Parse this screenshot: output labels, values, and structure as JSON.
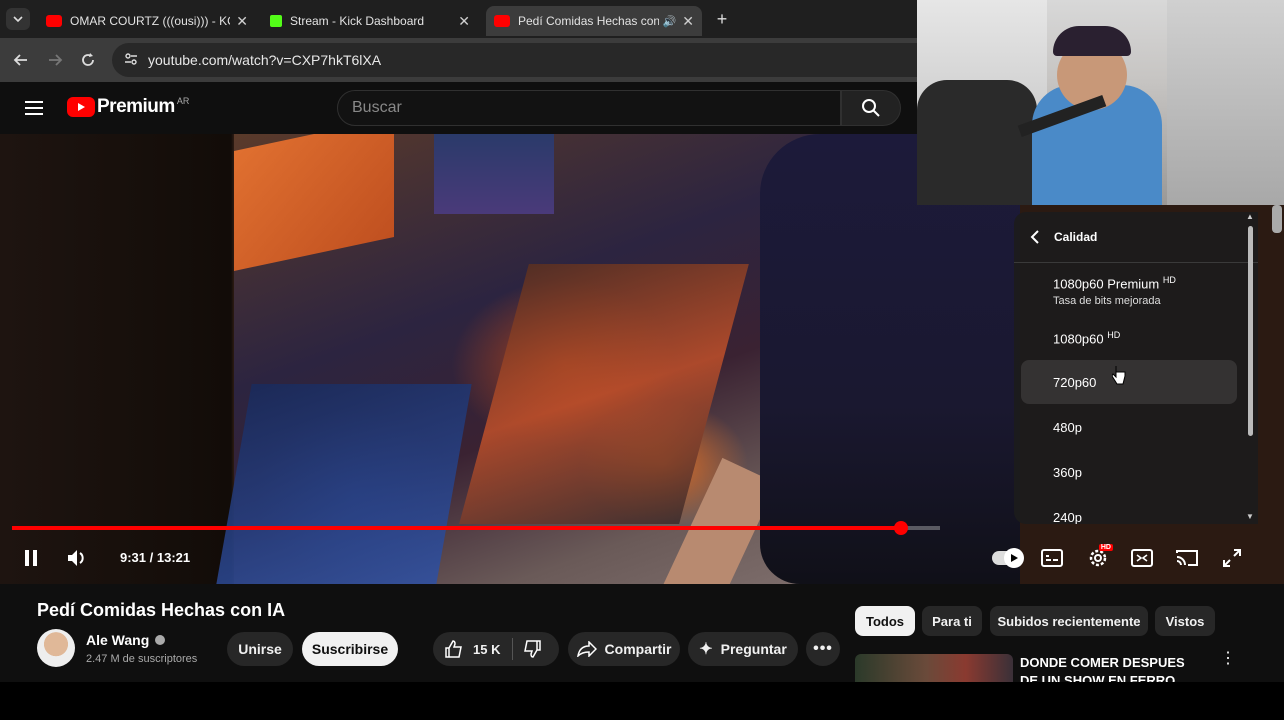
{
  "browser": {
    "tabs": [
      {
        "title": "OMAR COURTZ (((ousi))) - KOK",
        "favicon": "youtube-icon"
      },
      {
        "title": "Stream - Kick Dashboard",
        "favicon": "kick-icon"
      },
      {
        "title": "Pedí Comidas Hechas con I",
        "favicon": "youtube-icon"
      }
    ],
    "url": "youtube.com/watch?v=CXP7hkT6lXA"
  },
  "youtube": {
    "logo_text": "Premium",
    "region": "AR",
    "search_placeholder": "Buscar"
  },
  "player": {
    "time": "9:31 / 13:21",
    "progress": 0.958,
    "buffered": 1.0,
    "quality_menu": {
      "title": "Calidad",
      "options": [
        {
          "label": "1080p60 Premium",
          "badge": "HD",
          "sublabel": "Tasa de bits mejorada"
        },
        {
          "label": "1080p60",
          "badge": "HD"
        },
        {
          "label": "720p60",
          "badge": ""
        },
        {
          "label": "480p",
          "badge": ""
        },
        {
          "label": "360p",
          "badge": ""
        },
        {
          "label": "240p",
          "badge": ""
        }
      ],
      "highlighted": "720p60"
    },
    "settings_badge": "HD"
  },
  "video": {
    "title": "Pedí Comidas Hechas con IA",
    "channel": "Ale Wang",
    "subscribers": "2.47 M de suscriptores",
    "join_label": "Unirse",
    "subscribe_label": "Suscribirse",
    "likes": "15 K",
    "share_label": "Compartir",
    "ask_label": "Preguntar"
  },
  "sidebar": {
    "chips": [
      "Todos",
      "Para ti",
      "Subidos recientemente",
      "Vistos"
    ],
    "next_video_title": "DONDE COMER DESPUES DE UN SHOW EN FERRO"
  },
  "colors": {
    "accent": "#ff0000",
    "kick": "#53fc18"
  }
}
